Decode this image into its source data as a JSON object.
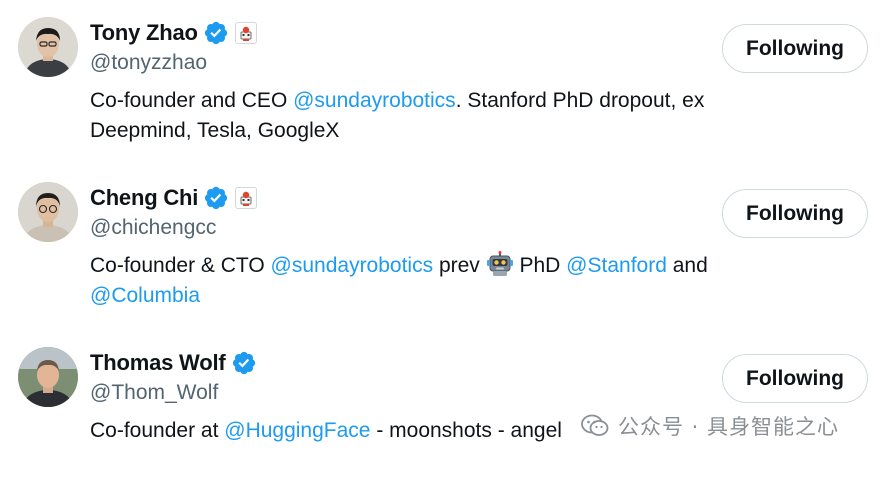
{
  "users": [
    {
      "display_name": "Tony Zhao",
      "handle": "@tonyzzhao",
      "follow_label": "Following",
      "bio": {
        "t1": "Co-founder and CEO ",
        "m1": "@sundayrobotics",
        "t2": ". Stanford PhD dropout, ex Deepmind, Tesla, GoogleX"
      }
    },
    {
      "display_name": "Cheng Chi",
      "handle": "@chichengcc",
      "follow_label": "Following",
      "bio": {
        "t1": "Co-founder & CTO ",
        "m1": "@sundayrobotics",
        "t2": " prev ",
        "t3": " PhD ",
        "m2": "@Stanford",
        "t4": " and ",
        "m3": "@Columbia"
      }
    },
    {
      "display_name": "Thomas Wolf",
      "handle": "@Thom_Wolf",
      "follow_label": "Following",
      "bio": {
        "t1": "Co-founder at ",
        "m1": "@HuggingFace",
        "t2": " - moonshots - angel"
      }
    }
  ],
  "watermark": {
    "text": "公众号 · 具身智能之心",
    "icon": "wechat-icon"
  },
  "icons": {
    "verified": "verified-badge-icon",
    "affiliate": "affiliate-badge-icon",
    "robot_emoji": "robot-emoji-icon"
  },
  "colors": {
    "mention": "#1d9bf0",
    "verified": "#1d9bf0",
    "handle": "#536471",
    "text": "#0f1419",
    "button_border": "#cfd9de",
    "watermark": "#8a8f94"
  }
}
